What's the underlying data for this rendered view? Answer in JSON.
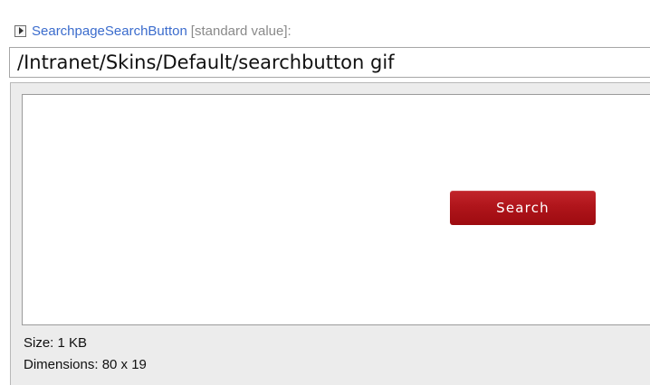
{
  "field": {
    "name": "SearchpageSearchButton",
    "standard_value_label": "[standard value]",
    "colon": ":",
    "expand_icon": "expand-triangle-icon"
  },
  "path_input": {
    "value": "/Intranet/Skins/Default/searchbutton gif"
  },
  "preview": {
    "button_label": "Search",
    "button_color": "#b0151b"
  },
  "info": {
    "size": "Size: 1 KB",
    "dimensions": "Dimensions: 80 x 19"
  }
}
